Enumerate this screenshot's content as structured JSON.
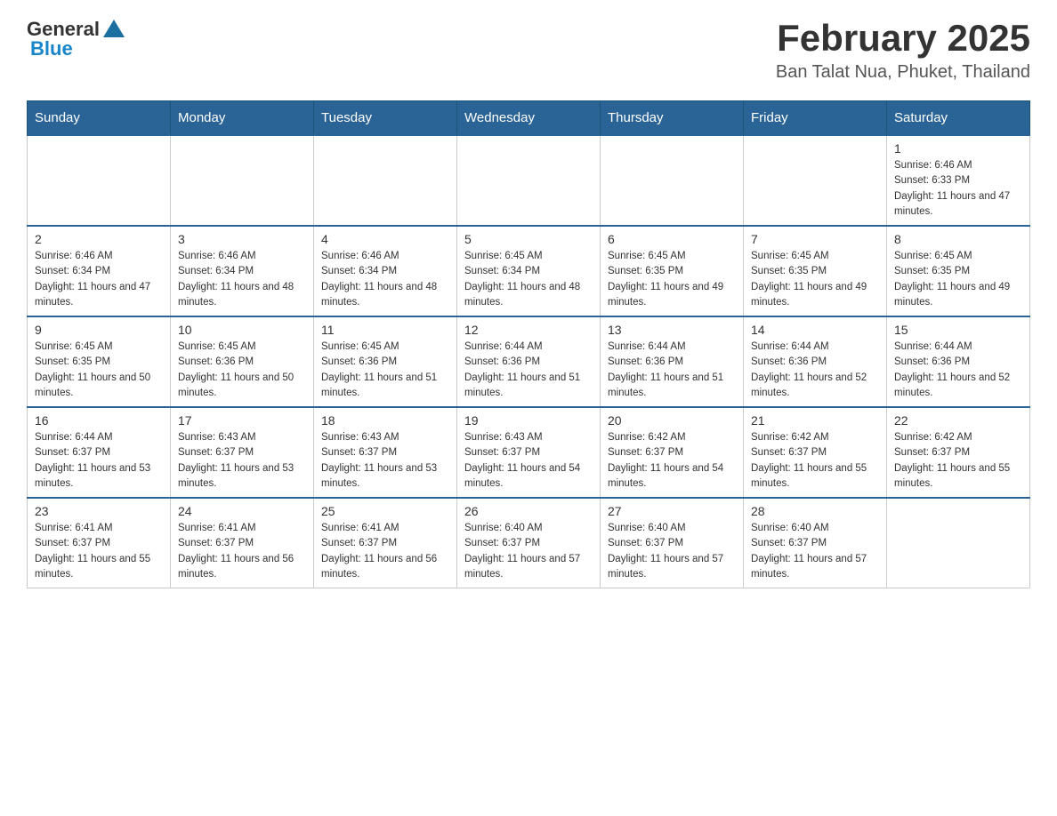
{
  "logo": {
    "general": "General",
    "blue": "Blue"
  },
  "title": "February 2025",
  "subtitle": "Ban Talat Nua, Phuket, Thailand",
  "days_of_week": [
    "Sunday",
    "Monday",
    "Tuesday",
    "Wednesday",
    "Thursday",
    "Friday",
    "Saturday"
  ],
  "weeks": [
    [
      {
        "day": "",
        "info": ""
      },
      {
        "day": "",
        "info": ""
      },
      {
        "day": "",
        "info": ""
      },
      {
        "day": "",
        "info": ""
      },
      {
        "day": "",
        "info": ""
      },
      {
        "day": "",
        "info": ""
      },
      {
        "day": "1",
        "info": "Sunrise: 6:46 AM\nSunset: 6:33 PM\nDaylight: 11 hours and 47 minutes."
      }
    ],
    [
      {
        "day": "2",
        "info": "Sunrise: 6:46 AM\nSunset: 6:34 PM\nDaylight: 11 hours and 47 minutes."
      },
      {
        "day": "3",
        "info": "Sunrise: 6:46 AM\nSunset: 6:34 PM\nDaylight: 11 hours and 48 minutes."
      },
      {
        "day": "4",
        "info": "Sunrise: 6:46 AM\nSunset: 6:34 PM\nDaylight: 11 hours and 48 minutes."
      },
      {
        "day": "5",
        "info": "Sunrise: 6:45 AM\nSunset: 6:34 PM\nDaylight: 11 hours and 48 minutes."
      },
      {
        "day": "6",
        "info": "Sunrise: 6:45 AM\nSunset: 6:35 PM\nDaylight: 11 hours and 49 minutes."
      },
      {
        "day": "7",
        "info": "Sunrise: 6:45 AM\nSunset: 6:35 PM\nDaylight: 11 hours and 49 minutes."
      },
      {
        "day": "8",
        "info": "Sunrise: 6:45 AM\nSunset: 6:35 PM\nDaylight: 11 hours and 49 minutes."
      }
    ],
    [
      {
        "day": "9",
        "info": "Sunrise: 6:45 AM\nSunset: 6:35 PM\nDaylight: 11 hours and 50 minutes."
      },
      {
        "day": "10",
        "info": "Sunrise: 6:45 AM\nSunset: 6:36 PM\nDaylight: 11 hours and 50 minutes."
      },
      {
        "day": "11",
        "info": "Sunrise: 6:45 AM\nSunset: 6:36 PM\nDaylight: 11 hours and 51 minutes."
      },
      {
        "day": "12",
        "info": "Sunrise: 6:44 AM\nSunset: 6:36 PM\nDaylight: 11 hours and 51 minutes."
      },
      {
        "day": "13",
        "info": "Sunrise: 6:44 AM\nSunset: 6:36 PM\nDaylight: 11 hours and 51 minutes."
      },
      {
        "day": "14",
        "info": "Sunrise: 6:44 AM\nSunset: 6:36 PM\nDaylight: 11 hours and 52 minutes."
      },
      {
        "day": "15",
        "info": "Sunrise: 6:44 AM\nSunset: 6:36 PM\nDaylight: 11 hours and 52 minutes."
      }
    ],
    [
      {
        "day": "16",
        "info": "Sunrise: 6:44 AM\nSunset: 6:37 PM\nDaylight: 11 hours and 53 minutes."
      },
      {
        "day": "17",
        "info": "Sunrise: 6:43 AM\nSunset: 6:37 PM\nDaylight: 11 hours and 53 minutes."
      },
      {
        "day": "18",
        "info": "Sunrise: 6:43 AM\nSunset: 6:37 PM\nDaylight: 11 hours and 53 minutes."
      },
      {
        "day": "19",
        "info": "Sunrise: 6:43 AM\nSunset: 6:37 PM\nDaylight: 11 hours and 54 minutes."
      },
      {
        "day": "20",
        "info": "Sunrise: 6:42 AM\nSunset: 6:37 PM\nDaylight: 11 hours and 54 minutes."
      },
      {
        "day": "21",
        "info": "Sunrise: 6:42 AM\nSunset: 6:37 PM\nDaylight: 11 hours and 55 minutes."
      },
      {
        "day": "22",
        "info": "Sunrise: 6:42 AM\nSunset: 6:37 PM\nDaylight: 11 hours and 55 minutes."
      }
    ],
    [
      {
        "day": "23",
        "info": "Sunrise: 6:41 AM\nSunset: 6:37 PM\nDaylight: 11 hours and 55 minutes."
      },
      {
        "day": "24",
        "info": "Sunrise: 6:41 AM\nSunset: 6:37 PM\nDaylight: 11 hours and 56 minutes."
      },
      {
        "day": "25",
        "info": "Sunrise: 6:41 AM\nSunset: 6:37 PM\nDaylight: 11 hours and 56 minutes."
      },
      {
        "day": "26",
        "info": "Sunrise: 6:40 AM\nSunset: 6:37 PM\nDaylight: 11 hours and 57 minutes."
      },
      {
        "day": "27",
        "info": "Sunrise: 6:40 AM\nSunset: 6:37 PM\nDaylight: 11 hours and 57 minutes."
      },
      {
        "day": "28",
        "info": "Sunrise: 6:40 AM\nSunset: 6:37 PM\nDaylight: 11 hours and 57 minutes."
      },
      {
        "day": "",
        "info": ""
      }
    ]
  ]
}
